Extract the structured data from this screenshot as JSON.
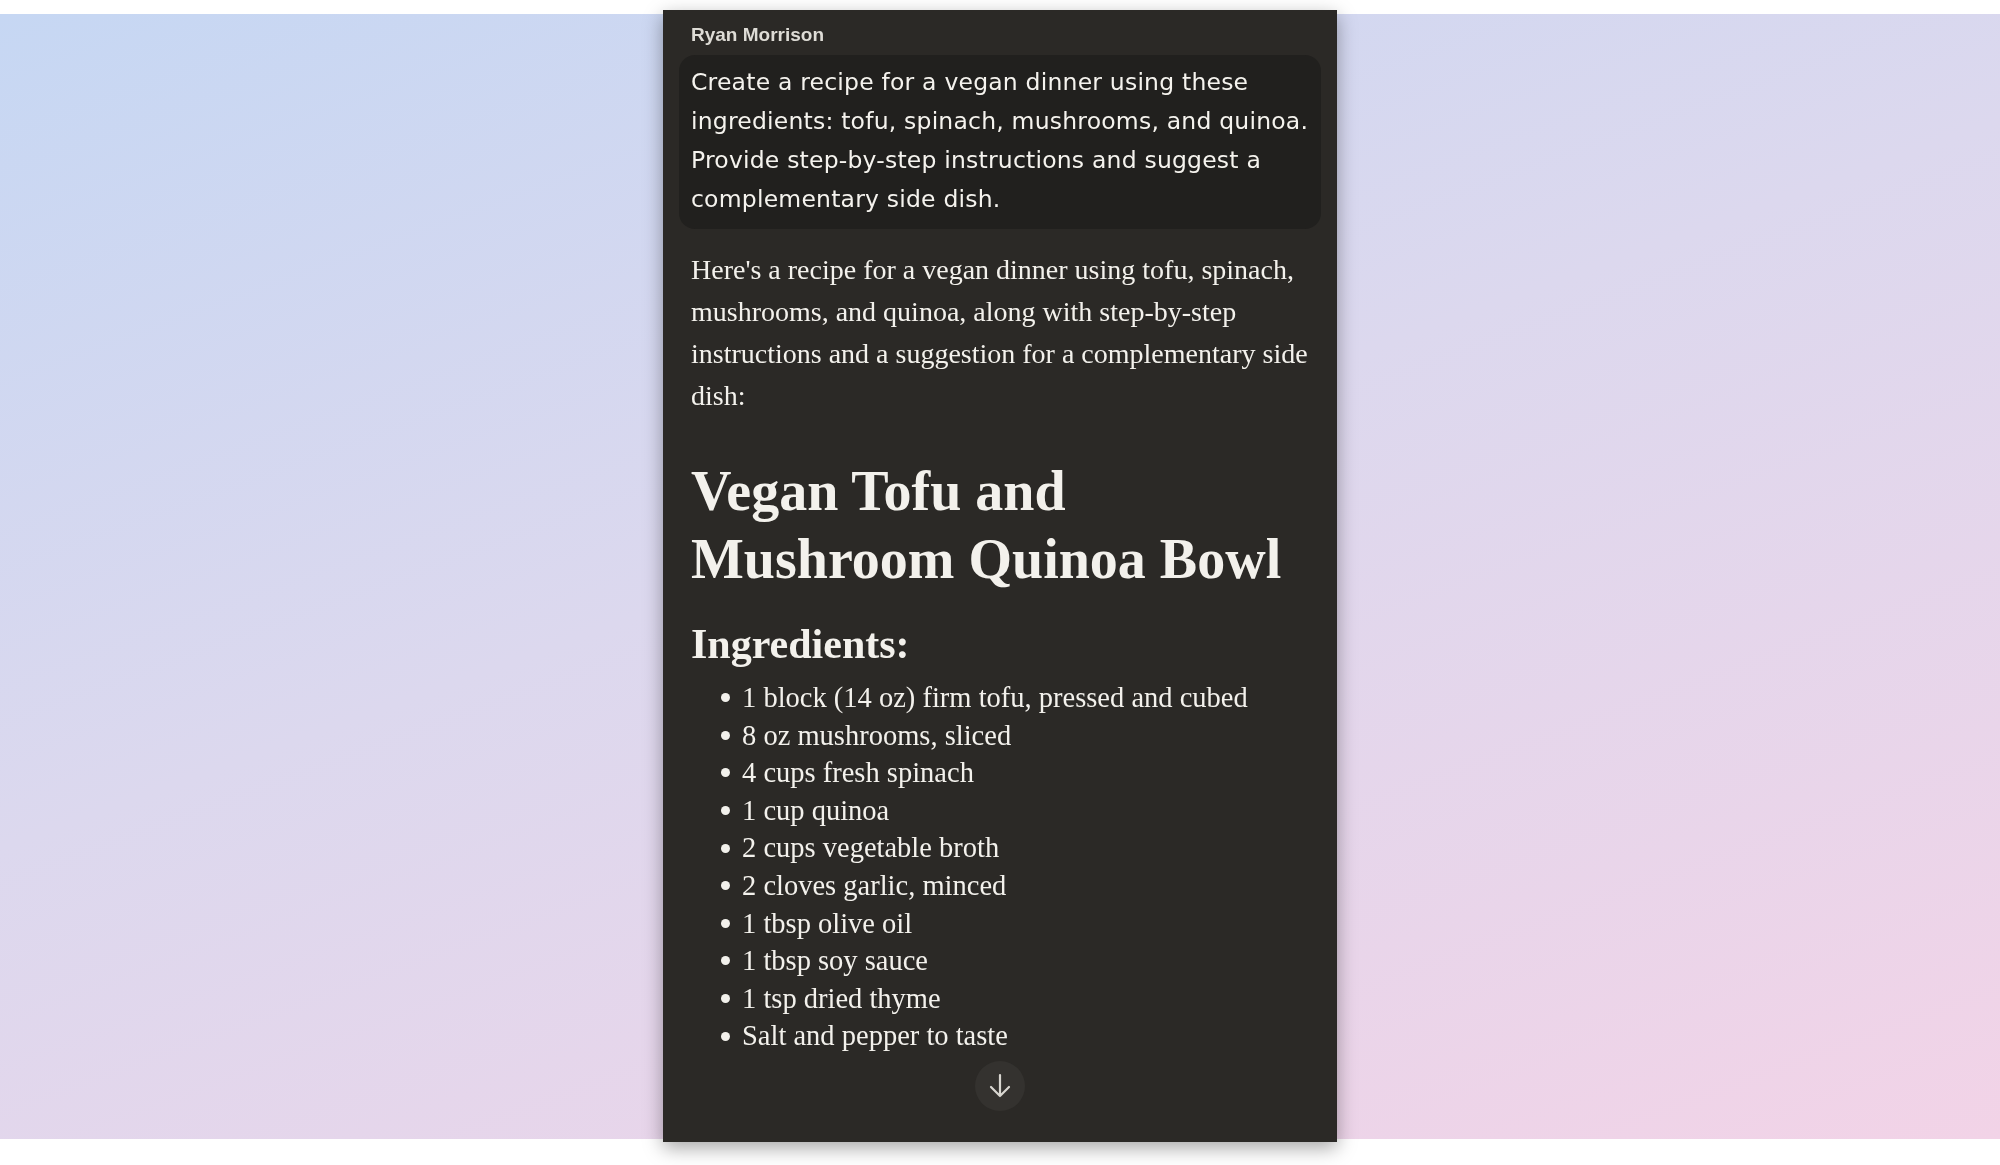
{
  "message": {
    "author": "Ryan Morrison",
    "prompt": "Create a recipe for a vegan dinner using these ingredients: tofu, spinach, mushrooms, and quinoa. Provide step-by-step instructions and suggest a complementary side dish."
  },
  "response": {
    "intro": "Here's a recipe for a vegan dinner using tofu, spinach, mushrooms, and quinoa, along with step-by-step instructions and a suggestion for a complementary side dish:",
    "title": "Vegan Tofu and Mushroom Quinoa Bowl",
    "section": "Ingredients:",
    "items": [
      "1 block (14 oz) firm tofu, pressed and cubed",
      "8 oz mushrooms, sliced",
      "4 cups fresh spinach",
      "1 cup quinoa",
      "2 cups vegetable broth",
      "2 cloves garlic, minced",
      "1 tbsp olive oil",
      "1 tbsp soy sauce",
      "1 tsp dried thyme",
      "Salt and pepper to taste"
    ]
  }
}
